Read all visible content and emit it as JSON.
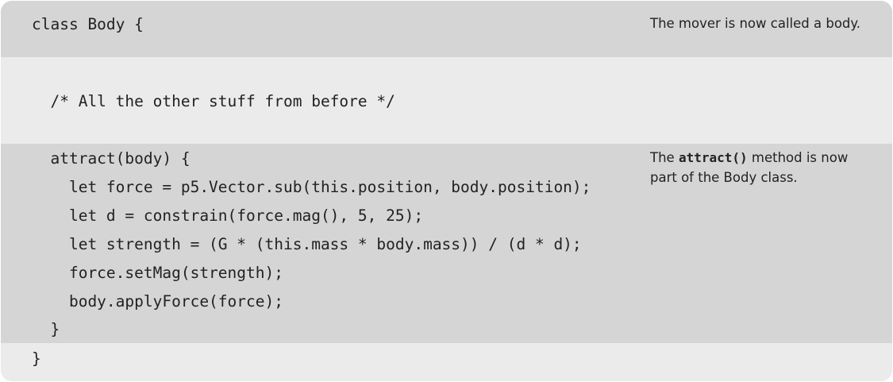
{
  "sections": [
    {
      "lines": [
        "class Body {"
      ],
      "note": "The mover is now called a body."
    },
    {
      "lines": [
        "  /* All the other stuff from before */"
      ],
      "note": ""
    },
    {
      "lines": [
        "  attract(body) {",
        "    let force = p5.Vector.sub(this.position, body.position);",
        "    let d = constrain(force.mag(), 5, 25);",
        "    let strength = (G * (this.mass * body.mass)) / (d * d);",
        "    force.setMag(strength);",
        "    body.applyForce(force);",
        "  }"
      ],
      "note": {
        "before": "The ",
        "code": "attract()",
        "after": " method is now part of the Body class."
      }
    },
    {
      "lines": [
        "}"
      ],
      "note": ""
    }
  ]
}
